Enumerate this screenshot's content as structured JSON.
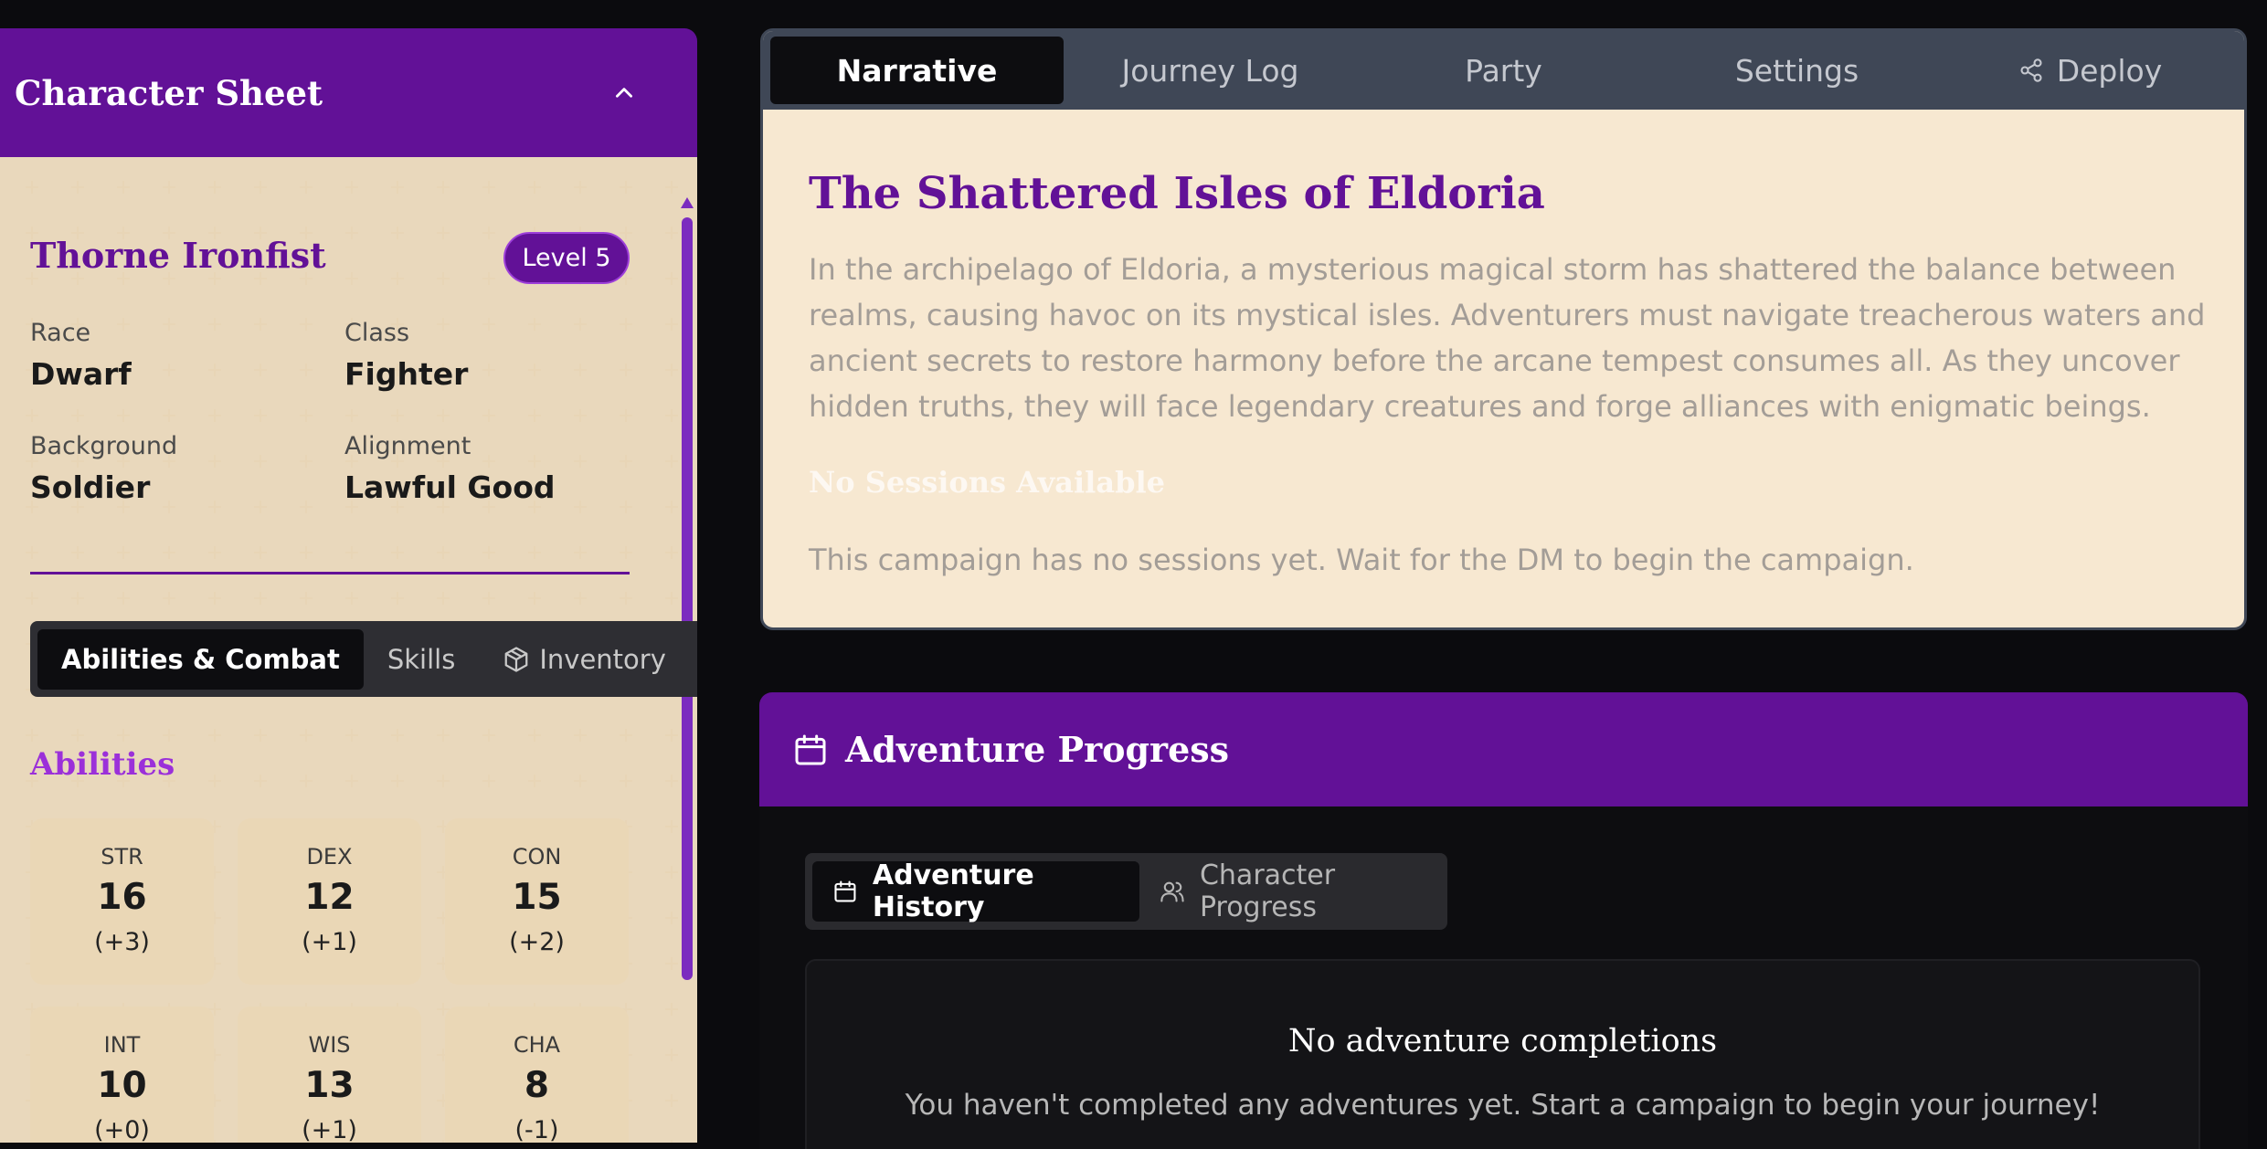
{
  "character_sheet": {
    "title": "Character Sheet",
    "name": "Thorne Ironfist",
    "level": "Level 5",
    "info": [
      {
        "label": "Race",
        "value": "Dwarf"
      },
      {
        "label": "Class",
        "value": "Fighter"
      },
      {
        "label": "Background",
        "value": "Soldier"
      },
      {
        "label": "Alignment",
        "value": "Lawful Good"
      }
    ],
    "tabs": [
      {
        "label": "Abilities & Combat",
        "active": true
      },
      {
        "label": "Skills",
        "active": false
      },
      {
        "label": "Inventory",
        "active": false,
        "icon": "box-icon"
      },
      {
        "label": "",
        "active": false,
        "icon": "wand-icon"
      }
    ],
    "abilities_title": "Abilities",
    "abilities": [
      {
        "name": "STR",
        "score": "16",
        "mod": "(+3)"
      },
      {
        "name": "DEX",
        "score": "12",
        "mod": "(+1)"
      },
      {
        "name": "CON",
        "score": "15",
        "mod": "(+2)"
      },
      {
        "name": "INT",
        "score": "10",
        "mod": "(+0)"
      },
      {
        "name": "WIS",
        "score": "13",
        "mod": "(+1)"
      },
      {
        "name": "CHA",
        "score": "8",
        "mod": "(-1)"
      }
    ]
  },
  "main_tabs": [
    {
      "label": "Narrative",
      "active": true
    },
    {
      "label": "Journey Log",
      "active": false
    },
    {
      "label": "Party",
      "active": false
    },
    {
      "label": "Settings",
      "active": false
    },
    {
      "label": "Deploy",
      "active": false,
      "icon": "share-icon"
    }
  ],
  "narrative": {
    "title": "The Shattered Isles of Eldoria",
    "description": "In the archipelago of Eldoria, a mysterious magical storm has shattered the balance between realms, causing havoc on its mystical isles. Adventurers must navigate treacherous waters and ancient secrets to restore harmony before the arcane tempest consumes all. As they uncover hidden truths, they will face legendary creatures and forge alliances with enigmatic beings.",
    "no_sessions_title": "No Sessions Available",
    "no_sessions_text": "This campaign has no sessions yet. Wait for the DM to begin the campaign."
  },
  "adventure_progress": {
    "title": "Adventure Progress",
    "tabs": [
      {
        "label": "Adventure History",
        "active": true,
        "icon": "calendar-icon"
      },
      {
        "label": "Character Progress",
        "active": false,
        "icon": "users-icon"
      }
    ],
    "empty_title": "No adventure completions",
    "empty_text": "You haven't completed any adventures yet. Start a campaign to begin your journey!"
  },
  "colors": {
    "brand_purple": "#621197",
    "parchment": "#f7e8d1",
    "tab_bar": "#3f4756",
    "dark_bg": "#0b0b0e"
  }
}
